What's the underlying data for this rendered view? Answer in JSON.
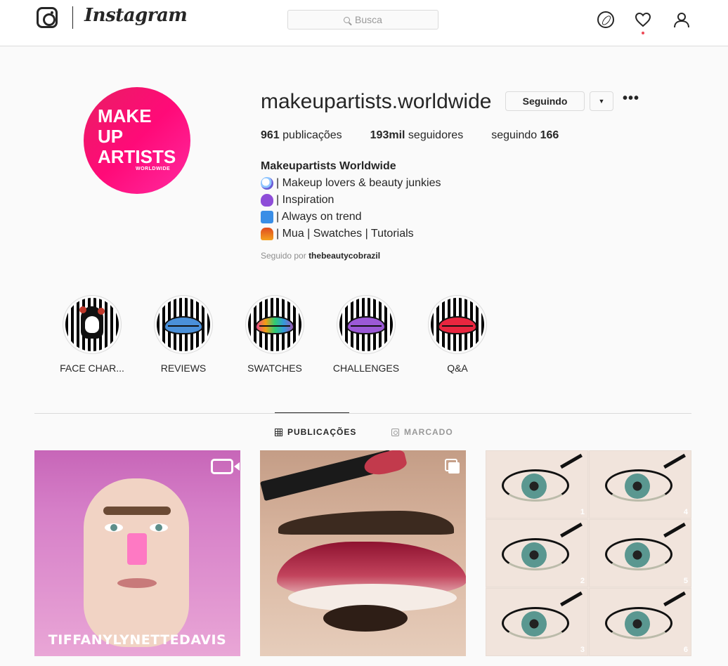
{
  "nav": {
    "wordmark": "Instagram",
    "search_placeholder": "Busca"
  },
  "profile": {
    "avatar_lines": [
      "MAKE",
      "UP",
      "ARTISTS"
    ],
    "avatar_sub": "WORLDWIDE",
    "username": "makeupartists.worldwide",
    "follow_label": "Seguindo",
    "more_label": "•••",
    "stats": {
      "posts_count": "961",
      "posts_label": "publicações",
      "followers_count": "193mil",
      "followers_label": "seguidores",
      "following_label": "seguindo",
      "following_count": "166"
    },
    "bio": {
      "name": "Makeupartists Worldwide",
      "lines": [
        "| Makeup lovers & beauty junkies",
        "| Inspiration",
        "| Always on trend",
        "| Mua | Swatches | Tutorials"
      ],
      "line_icons": [
        "unicorn-icon",
        "purple-heart-icon",
        "top-icon",
        "lipstick-icon"
      ]
    },
    "followed_by_label": "Seguido por",
    "followed_by_user": "thebeautycobrazil"
  },
  "highlights": [
    {
      "label": "FACE CHAR...",
      "art": "sugar-skull",
      "color": "#111111"
    },
    {
      "label": "REVIEWS",
      "art": "lips",
      "color": "#4a90d9"
    },
    {
      "label": "SWATCHES",
      "art": "lips",
      "color": "#e84a8a"
    },
    {
      "label": "CHALLENGES",
      "art": "lips",
      "color": "#9b59d6"
    },
    {
      "label": "Q&A",
      "art": "lips",
      "color": "#e8263f"
    }
  ],
  "tabs": {
    "posts": "PUBLICAÇÕES",
    "tagged": "MARCADO"
  },
  "posts": [
    {
      "type": "video",
      "caption": "TIFFANYLYNETTEDAVIS"
    },
    {
      "type": "carousel",
      "caption": ""
    },
    {
      "type": "image",
      "caption": "",
      "step_numbers": [
        "1",
        "4",
        "2",
        "5",
        "3",
        "6"
      ]
    }
  ],
  "colors": {
    "notification_dot": "#ed4956",
    "avatar_gradient": "#ff0a78"
  }
}
